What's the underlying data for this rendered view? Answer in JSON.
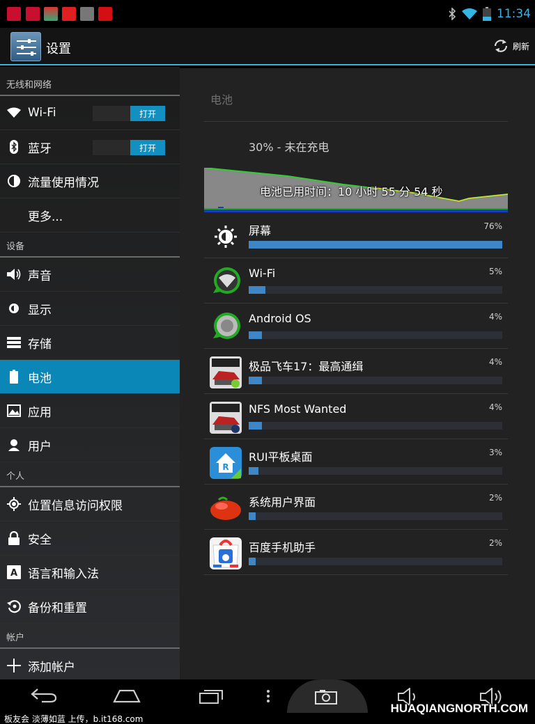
{
  "status_bar": {
    "time": "11:34",
    "notification_icons": [
      "news-icon",
      "news-icon",
      "weather-icon",
      "netease-icon",
      "image-icon",
      "shop-icon"
    ]
  },
  "action_bar": {
    "title": "设置",
    "refresh_label": "刷新"
  },
  "sidebar": {
    "sections": [
      {
        "header": "无线和网络",
        "items": [
          {
            "label": "Wi-Fi",
            "icon": "wifi-icon",
            "toggle": "打开"
          },
          {
            "label": "蓝牙",
            "icon": "bluetooth-icon",
            "toggle": "打开"
          },
          {
            "label": "流量使用情况",
            "icon": "data-usage-icon"
          },
          {
            "label": "更多...",
            "icon": ""
          }
        ]
      },
      {
        "header": "设备",
        "items": [
          {
            "label": "声音",
            "icon": "sound-icon"
          },
          {
            "label": "显示",
            "icon": "display-icon"
          },
          {
            "label": "存储",
            "icon": "storage-icon"
          },
          {
            "label": "电池",
            "icon": "battery-icon",
            "selected": true
          },
          {
            "label": "应用",
            "icon": "apps-icon"
          },
          {
            "label": "用户",
            "icon": "user-icon"
          }
        ]
      },
      {
        "header": "个人",
        "items": [
          {
            "label": "位置信息访问权限",
            "icon": "location-icon"
          },
          {
            "label": "安全",
            "icon": "lock-icon"
          },
          {
            "label": "语言和输入法",
            "icon": "language-icon"
          },
          {
            "label": "备份和重置",
            "icon": "backup-icon"
          }
        ]
      },
      {
        "header": "帐户",
        "items": [
          {
            "label": "添加帐户",
            "icon": "add-icon"
          }
        ]
      }
    ]
  },
  "battery": {
    "title": "电池",
    "status": "30% - 未在充电",
    "usage_time": "电池已用时间：10 小时 55 分 54 秒",
    "apps": [
      {
        "name": "屏幕",
        "percent": "76%",
        "value": 76,
        "icon": "screen-brightness-icon"
      },
      {
        "name": "Wi-Fi",
        "percent": "5%",
        "value": 5,
        "icon": "wifi-app-icon"
      },
      {
        "name": "Android OS",
        "percent": "4%",
        "value": 4,
        "icon": "android-os-icon"
      },
      {
        "name": "极品飞车17：最高通缉",
        "percent": "4%",
        "value": 4,
        "icon": "nfs-game-icon"
      },
      {
        "name": "NFS Most Wanted",
        "percent": "4%",
        "value": 4,
        "icon": "nfs-ea-icon"
      },
      {
        "name": "RUI平板桌面",
        "percent": "3%",
        "value": 3,
        "icon": "rui-launcher-icon"
      },
      {
        "name": "系统用户界面",
        "percent": "2%",
        "value": 2,
        "icon": "system-ui-icon"
      },
      {
        "name": "百度手机助手",
        "percent": "2%",
        "value": 2,
        "icon": "baidu-assistant-icon"
      }
    ]
  },
  "footer": {
    "left_text": "板友会 淡薄如蓝 上传，b.it168.com",
    "right_text": "HUAQIANGNORTH.COM"
  }
}
